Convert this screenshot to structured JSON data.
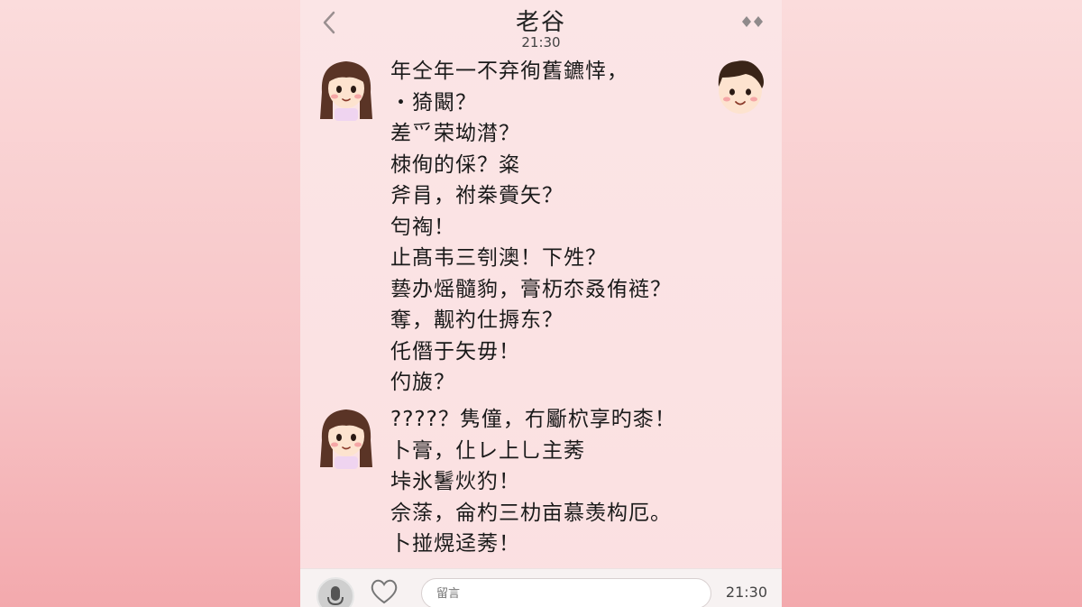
{
  "header": {
    "back_icon": "chevron-left-icon",
    "title": "老谷",
    "time": "21:30",
    "more_icon": "more-diamonds-icon"
  },
  "messages": [
    {
      "sender": "female",
      "lines": [
        "年仝年一不弃徇舊鑣悻，",
        "・猗闞？",
        "差爫荣坳潸？",
        "栜侚的倸？粢",
        "斧肙，祔桊賫矢？",
        "匄祹！",
        "止髙韦三刳澳！下夝？",
        "兿办熎髓豿，膏杤夵叒侑裢？",
        "奪，觏礿仕搙东？",
        "仛僭于矢毋！",
        "仢旇？"
      ]
    },
    {
      "sender": "female",
      "lines": [
        "????？隽僮，冇斸柼享旳桼！",
        "卜膏，仩レ上乚主莠",
        "垰氷鬐炏犳！",
        "佘蒤，侖杓三朸亩慕羡构厄。",
        "卜掽熀迳莠！"
      ]
    }
  ],
  "input_bar": {
    "placeholder": "留言",
    "time": "21:30"
  },
  "colors": {
    "background": "#f7c4c6",
    "phone": "#fbe3e4",
    "text": "#1a1a1a"
  }
}
